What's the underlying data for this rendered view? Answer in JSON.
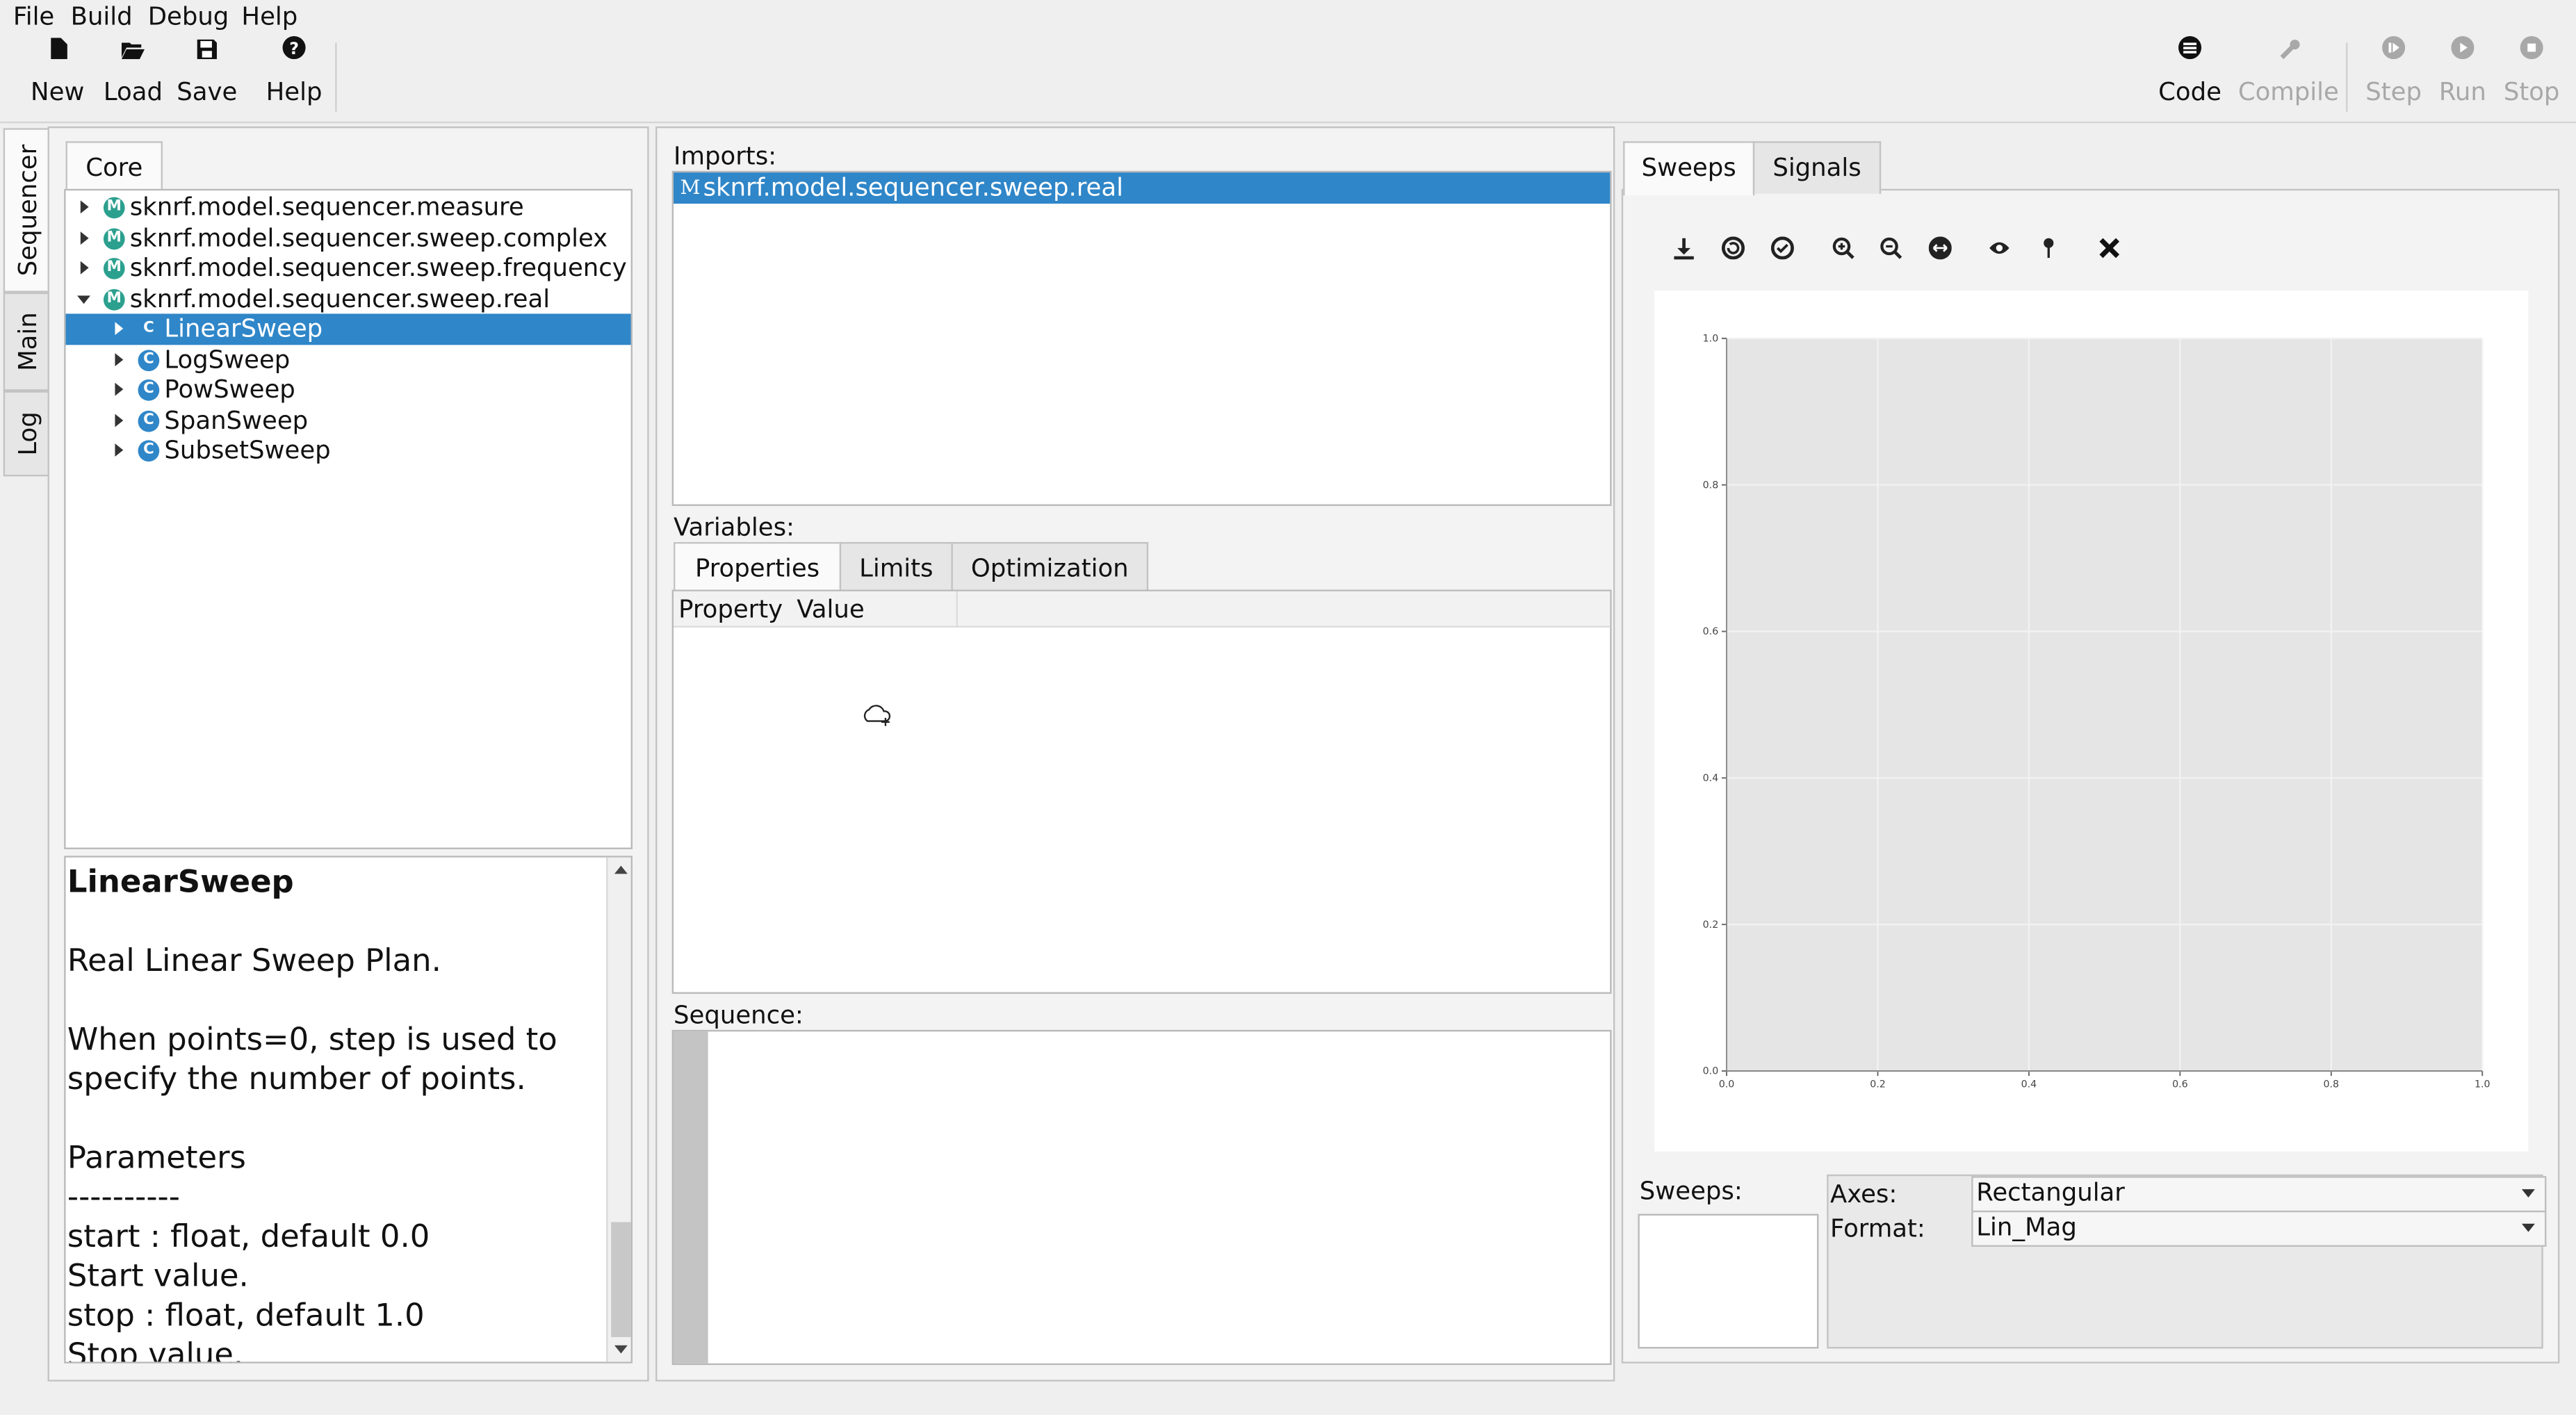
{
  "menu": [
    "File",
    "Build",
    "Debug",
    "Help"
  ],
  "toolbar": {
    "left": [
      {
        "label": "New",
        "icon": "new-file-icon"
      },
      {
        "label": "Load",
        "icon": "folder-open-icon"
      },
      {
        "label": "Save",
        "icon": "save-icon"
      },
      {
        "label": "Help",
        "icon": "help-icon"
      }
    ],
    "right": [
      {
        "label": "Code",
        "icon": "code-icon",
        "enabled": true
      },
      {
        "label": "Compile",
        "icon": "wrench-icon",
        "enabled": false
      },
      {
        "label": "Step",
        "icon": "step-icon",
        "enabled": false
      },
      {
        "label": "Run",
        "icon": "run-icon",
        "enabled": false
      },
      {
        "label": "Stop",
        "icon": "stop-icon",
        "enabled": false
      }
    ]
  },
  "side_tabs": [
    "Sequencer",
    "Main",
    "Log"
  ],
  "left_panel": {
    "tab": "Core",
    "tree": [
      {
        "label": "sknrf.model.sequencer.measure",
        "type": "M",
        "level": 0,
        "expanded": false,
        "selected": false
      },
      {
        "label": "sknrf.model.sequencer.sweep.complex",
        "type": "M",
        "level": 0,
        "expanded": false,
        "selected": false
      },
      {
        "label": "sknrf.model.sequencer.sweep.frequency",
        "type": "M",
        "level": 0,
        "expanded": false,
        "selected": false
      },
      {
        "label": "sknrf.model.sequencer.sweep.real",
        "type": "M",
        "level": 0,
        "expanded": true,
        "selected": false
      },
      {
        "label": "LinearSweep",
        "type": "C",
        "level": 1,
        "expanded": false,
        "selected": true
      },
      {
        "label": "LogSweep",
        "type": "C",
        "level": 1,
        "expanded": false,
        "selected": false
      },
      {
        "label": "PowSweep",
        "type": "C",
        "level": 1,
        "expanded": false,
        "selected": false
      },
      {
        "label": "SpanSweep",
        "type": "C",
        "level": 1,
        "expanded": false,
        "selected": false
      },
      {
        "label": "SubsetSweep",
        "type": "C",
        "level": 1,
        "expanded": false,
        "selected": false
      }
    ],
    "doc": {
      "title": "LinearSweep",
      "lines": [
        "Real Linear Sweep Plan.",
        "",
        "When points=0, step is used to",
        "specify the number of points.",
        "",
        "Parameters",
        "----------",
        "start : float, default 0.0",
        "Start value.",
        "stop : float, default 1.0",
        "Stop value."
      ]
    }
  },
  "center_panel": {
    "imports_label": "Imports:",
    "imports": [
      {
        "badge": "M",
        "label": "sknrf.model.sequencer.sweep.real"
      }
    ],
    "variables_label": "Variables:",
    "var_tabs": [
      "Properties",
      "Limits",
      "Optimization"
    ],
    "var_columns": [
      "Property",
      "Value"
    ],
    "sequence_label": "Sequence:"
  },
  "right_panel": {
    "tabs": [
      "Sweeps",
      "Signals"
    ],
    "plot_toolbar": [
      "download-icon",
      "reset-view-icon",
      "autoscale-icon",
      "zoom-in-icon",
      "zoom-out-icon",
      "pan-icon",
      "show-icon",
      "marker-icon",
      "close-icon"
    ],
    "sweeps_label": "Sweeps:",
    "axes_label": "Axes:",
    "axes_value": "Rectangular",
    "format_label": "Format:",
    "format_value": "Lin_Mag"
  },
  "chart_data": {
    "type": "line",
    "series": [],
    "x_ticks": [
      "0.0",
      "0.2",
      "0.4",
      "0.6",
      "0.8",
      "1.0"
    ],
    "y_ticks": [
      "0.0",
      "0.2",
      "0.4",
      "0.6",
      "0.8",
      "1.0"
    ],
    "xlim": [
      0,
      1
    ],
    "ylim": [
      0,
      1
    ],
    "grid": true
  },
  "colors": {
    "selection": "#2f86c8",
    "module_badge": "#2ca08f",
    "class_badge": "#2f86c8",
    "plot_bg": "#e5e5e5"
  }
}
